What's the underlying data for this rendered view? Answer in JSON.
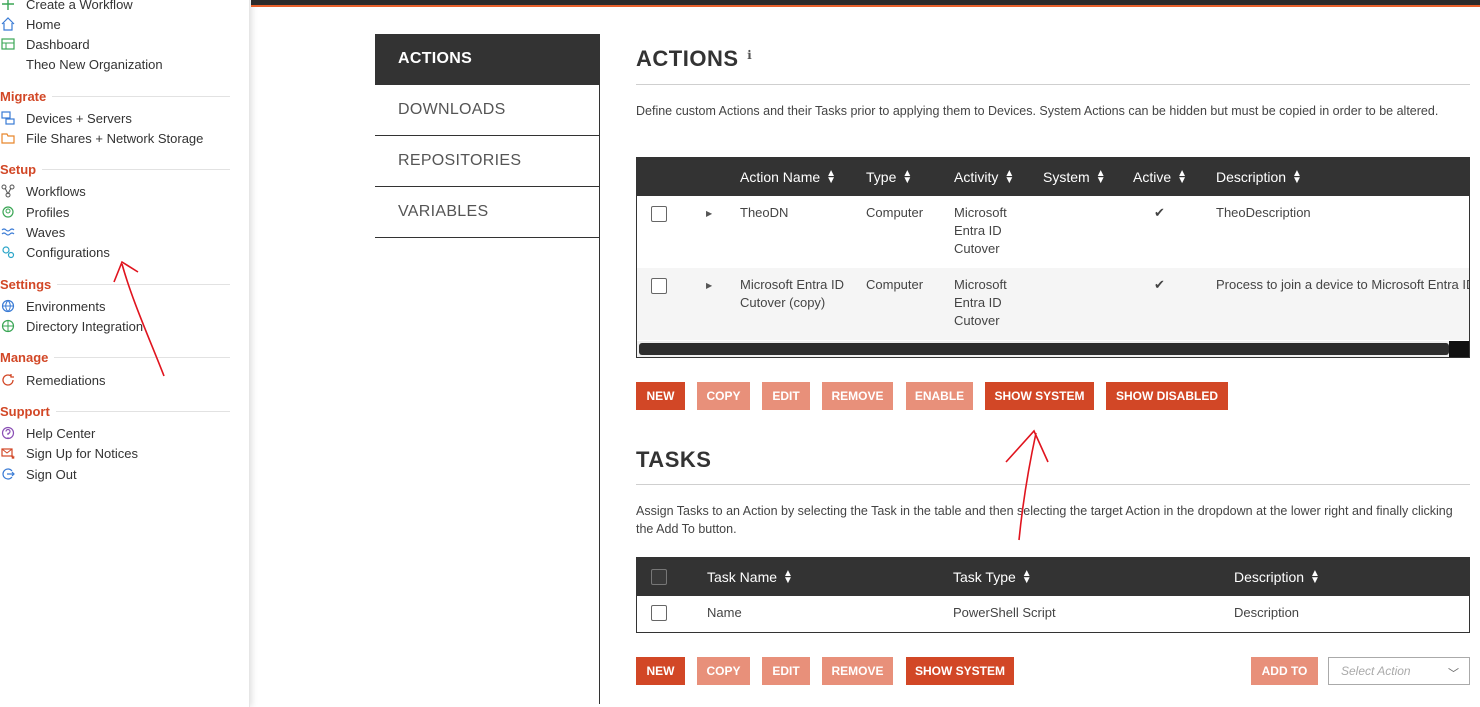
{
  "sidebar": {
    "top_items": [
      {
        "label": "Create a Workflow",
        "icon": "plus-icon"
      },
      {
        "label": "Home",
        "icon": "home-icon"
      },
      {
        "label": "Dashboard",
        "icon": "dashboard-icon"
      },
      {
        "label": "Theo New Organization",
        "icon": ""
      }
    ],
    "migrate": {
      "title": "Migrate",
      "items": [
        {
          "label": "Devices + Servers",
          "icon": "devices-icon"
        },
        {
          "label": "File Shares + Network Storage",
          "icon": "folder-icon"
        }
      ]
    },
    "setup": {
      "title": "Setup",
      "items": [
        {
          "label": "Workflows",
          "icon": "workflow-icon"
        },
        {
          "label": "Profiles",
          "icon": "profiles-icon"
        },
        {
          "label": "Waves",
          "icon": "waves-icon"
        },
        {
          "label": "Configurations",
          "icon": "gears-icon"
        }
      ]
    },
    "settings": {
      "title": "Settings",
      "items": [
        {
          "label": "Environments",
          "icon": "globe-icon"
        },
        {
          "label": "Directory Integration",
          "icon": "network-globe-icon"
        }
      ]
    },
    "manage": {
      "title": "Manage",
      "items": [
        {
          "label": "Remediations",
          "icon": "remediation-icon"
        }
      ]
    },
    "support": {
      "title": "Support",
      "items": [
        {
          "label": "Help Center",
          "icon": "help-icon"
        },
        {
          "label": "Sign Up for Notices",
          "icon": "mail-star-icon"
        },
        {
          "label": "Sign Out",
          "icon": "signout-icon"
        }
      ]
    }
  },
  "tabs": [
    "ACTIONS",
    "DOWNLOADS",
    "REPOSITORIES",
    "VARIABLES"
  ],
  "actions": {
    "title": "ACTIONS",
    "info_icon": "info-icon",
    "description": "Define custom Actions and their Tasks prior to applying them to Devices. System Actions can be hidden but must be copied in order to be altered.",
    "columns": [
      "Action Name",
      "Type",
      "Activity",
      "System",
      "Active",
      "Description"
    ],
    "rows": [
      {
        "name": "TheoDN",
        "type": "Computer",
        "activity": "Microsoft Entra ID Cutover",
        "system": "",
        "active": "✔",
        "description": "TheoDescription"
      },
      {
        "name": "Microsoft Entra ID Cutover (copy)",
        "type": "Computer",
        "activity": "Microsoft Entra ID Cutover",
        "system": "",
        "active": "✔",
        "description": "Process to join a device to Microsoft Entra ID"
      }
    ],
    "buttons": [
      "NEW",
      "COPY",
      "EDIT",
      "REMOVE",
      "ENABLE",
      "SHOW SYSTEM",
      "SHOW DISABLED"
    ]
  },
  "tasks": {
    "title": "TASKS",
    "description": "Assign Tasks to an Action by selecting the Task in the table and then selecting the target Action in the dropdown at the lower right and finally clicking the Add To button.",
    "columns": [
      "Task Name",
      "Task Type",
      "Description"
    ],
    "rows": [
      {
        "name": "Name",
        "type": "PowerShell Script",
        "description": "Description"
      }
    ],
    "buttons": [
      "NEW",
      "COPY",
      "EDIT",
      "REMOVE",
      "SHOW SYSTEM"
    ],
    "add_to": "ADD TO",
    "select_placeholder": "Select Action"
  },
  "colors": {
    "accent": "#d24726",
    "accent_muted": "#e8907a",
    "header_dark": "#333333",
    "annotation": "#e0141e"
  }
}
